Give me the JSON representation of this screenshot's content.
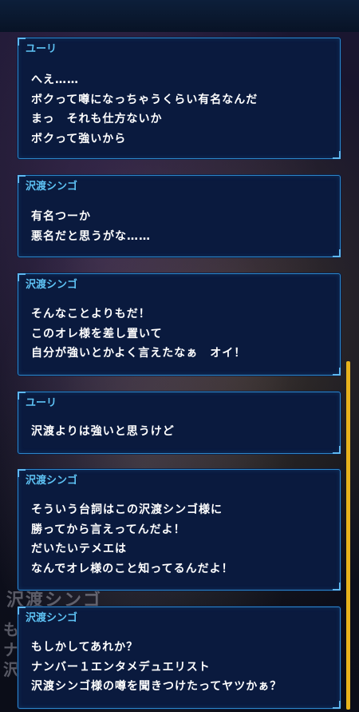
{
  "background": {
    "name_label": "沢渡シンゴ",
    "side_chars": [
      "も",
      "ナ",
      "沢"
    ]
  },
  "messages": [
    {
      "speaker": "ユーリ",
      "lines": [
        "へえ……",
        "ボクって噂になっちゃうくらい有名なんだ",
        "まっ　それも仕方ないか",
        "ボクって強いから"
      ]
    },
    {
      "speaker": "沢渡シンゴ",
      "lines": [
        "有名つーか",
        "悪名だと思うがな……"
      ]
    },
    {
      "speaker": "沢渡シンゴ",
      "lines": [
        "そんなことよりもだ！",
        "このオレ様を差し置いて",
        "自分が強いとかよく言えたなぁ　オイ！"
      ]
    },
    {
      "speaker": "ユーリ",
      "lines": [
        "沢渡よりは強いと思うけど"
      ]
    },
    {
      "speaker": "沢渡シンゴ",
      "lines": [
        "そういう台詞はこの沢渡シンゴ様に",
        "勝ってから言えってんだよ！",
        "だいたいテメエは",
        "なんでオレ様のこと知ってるんだよ！"
      ]
    },
    {
      "speaker": "沢渡シンゴ",
      "lines": [
        "もしかしてあれか？",
        "ナンバー１エンタメデュエリスト",
        "沢渡シンゴ様の噂を聞きつけたってヤツかぁ？"
      ]
    }
  ],
  "colors": {
    "speaker": "#5ec3f5",
    "bubble_bg": "#0a1a3e",
    "border": "#2d86c8",
    "scrollbar": "#e8b21c"
  }
}
